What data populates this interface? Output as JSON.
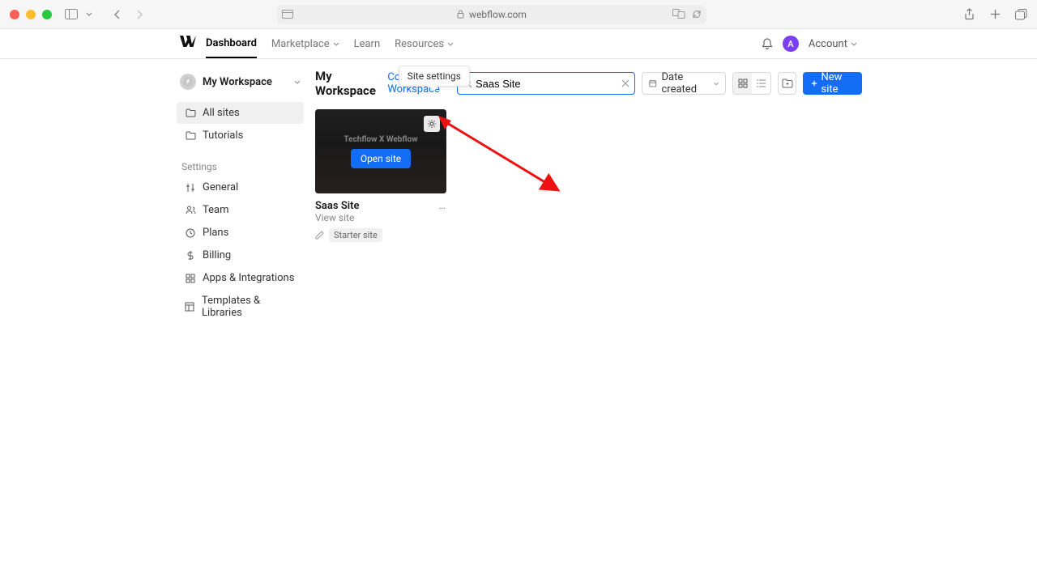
{
  "browser": {
    "url": "webflow.com"
  },
  "nav": {
    "tabs": [
      "Dashboard",
      "Marketplace",
      "Learn",
      "Resources"
    ],
    "account_label": "Account",
    "avatar_initial": "A"
  },
  "sidebar": {
    "workspace_name": "My Workspace",
    "items": [
      {
        "label": "All sites"
      },
      {
        "label": "Tutorials"
      }
    ],
    "settings_header": "Settings",
    "settings": [
      {
        "label": "General"
      },
      {
        "label": "Team"
      },
      {
        "label": "Plans"
      },
      {
        "label": "Billing"
      },
      {
        "label": "Apps & Integrations"
      },
      {
        "label": "Templates & Libraries"
      }
    ]
  },
  "header": {
    "title": "My Workspace",
    "core_link": "Core Workspace",
    "search_value": "Saas Site",
    "filter_label": "Date created",
    "new_site_label": "New site",
    "tooltip": "Site settings"
  },
  "site_card": {
    "thumb_fake_title": "Techflow X Webflow",
    "open_label": "Open site",
    "name": "Saas Site",
    "sub": "View site",
    "badge": "Starter site"
  }
}
